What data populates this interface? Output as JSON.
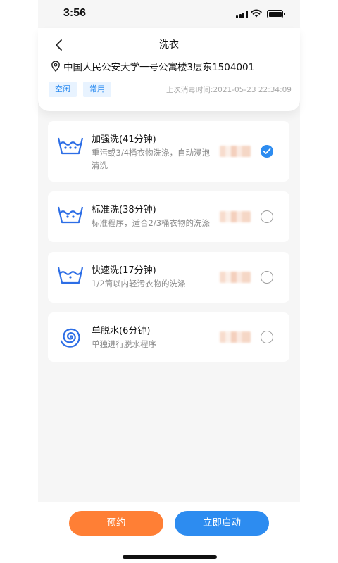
{
  "status_bar": {
    "time": "3:56"
  },
  "header": {
    "title": "洗衣",
    "address": "中国人民公安大学一号公寓楼3层东1504001",
    "tags": [
      "空闲",
      "常用"
    ],
    "last_disinfect": "上次消毒时间:2021-05-23 22:34:09"
  },
  "programs": [
    {
      "name": "加强洗(41分钟)",
      "description": "重污或3/4桶衣物洗涤，自动浸泡清洗",
      "icon": "washing-heavy-icon",
      "selected": true
    },
    {
      "name": "标准洗(38分钟)",
      "description": "标准程序，适合2/3桶衣物的洗涤",
      "icon": "washing-standard-icon",
      "selected": false
    },
    {
      "name": "快速洗(17分钟)",
      "description": "1/2筒以内轻污衣物的洗涤",
      "icon": "washing-quick-icon",
      "selected": false
    },
    {
      "name": "单脱水(6分钟)",
      "description": "单独进行脱水程序",
      "icon": "spin-dry-icon",
      "selected": false
    }
  ],
  "actions": {
    "reserve_label": "预约",
    "start_label": "立即启动"
  },
  "colors": {
    "accent": "#2d8cf0",
    "reserve": "#ff7f35",
    "tag_bg": "#e8f3ff",
    "page_bg": "#f6f6f6"
  }
}
